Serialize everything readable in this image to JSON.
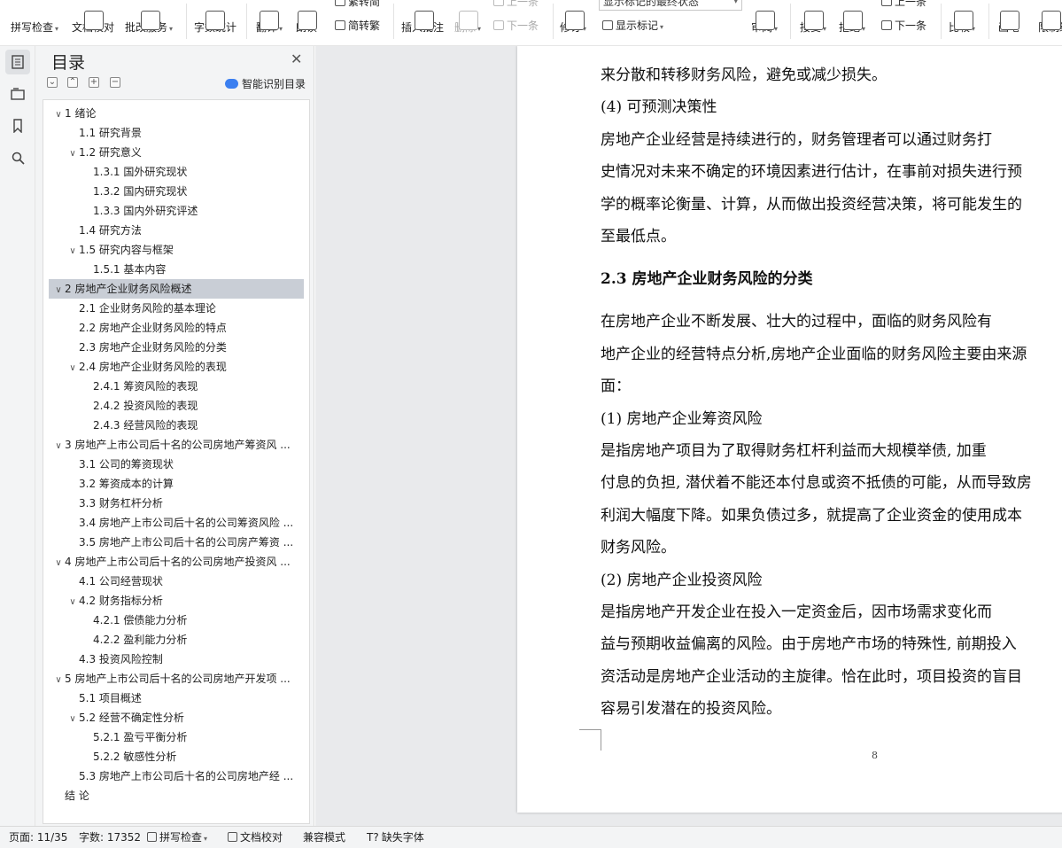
{
  "ribbon": {
    "spell_check": "拼写检查",
    "doc_proofread": "文档校对",
    "review_service": "批改服务",
    "word_count": "字数统计",
    "translate": "翻译",
    "read_aloud": "朗读",
    "trad_to_simp_top": "繁转简",
    "simp_to_trad": "简转繁",
    "insert_comment": "插入批注",
    "delete": "删除",
    "prev_comment": "上一条",
    "next_comment": "下一条",
    "revise": "修订",
    "markup_state": "显示标记的最终状态",
    "show_markup": "显示标记",
    "review": "审阅",
    "accept": "接受",
    "reject": "拒绝",
    "prev_change": "上一条",
    "next_change": "下一条",
    "compare": "比较",
    "pen": "画笔",
    "restrict": "限制编"
  },
  "toc": {
    "title": "目录",
    "smart_button": "智能识别目录",
    "items": [
      {
        "label": "1  绪论",
        "level": 1,
        "expandable": true
      },
      {
        "label": "1.1 研究背景",
        "level": 2,
        "expandable": false
      },
      {
        "label": "1.2 研究意义",
        "level": 2,
        "expandable": true
      },
      {
        "label": "1.3.1 国外研究现状",
        "level": 3,
        "expandable": false
      },
      {
        "label": "1.3.2 国内研究现状",
        "level": 3,
        "expandable": false
      },
      {
        "label": "1.3.3 国内外研究评述",
        "level": 3,
        "expandable": false
      },
      {
        "label": "1.4 研究方法",
        "level": 2,
        "expandable": false
      },
      {
        "label": "1.5 研究内容与框架",
        "level": 2,
        "expandable": true
      },
      {
        "label": "1.5.1 基本内容",
        "level": 3,
        "expandable": false
      },
      {
        "label": "2 房地产企业财务风险概述",
        "level": 1,
        "expandable": true,
        "selected": true
      },
      {
        "label": "2.1  企业财务风险的基本理论",
        "level": 2,
        "expandable": false
      },
      {
        "label": "2.2 房地产企业财务风险的特点",
        "level": 2,
        "expandable": false
      },
      {
        "label": "2.3 房地产企业财务风险的分类",
        "level": 2,
        "expandable": false
      },
      {
        "label": "2.4 房地产企业财务风险的表现",
        "level": 2,
        "expandable": true
      },
      {
        "label": "2.4.1 筹资风险的表现",
        "level": 3,
        "expandable": false
      },
      {
        "label": "2.4.2 投资风险的表现",
        "level": 3,
        "expandable": false
      },
      {
        "label": "2.4.3 经营风险的表现",
        "level": 3,
        "expandable": false
      },
      {
        "label": "3 房地产上市公司后十名的公司房地产筹资风 ...",
        "level": 1,
        "expandable": true
      },
      {
        "label": "3.1 公司的筹资现状",
        "level": 2,
        "expandable": false
      },
      {
        "label": "3.2 筹资成本的计算",
        "level": 2,
        "expandable": false
      },
      {
        "label": "3.3 财务杠杆分析",
        "level": 2,
        "expandable": false
      },
      {
        "label": "3.4 房地产上市公司后十名的公司筹资风险 ...",
        "level": 2,
        "expandable": false
      },
      {
        "label": "3.5 房地产上市公司后十名的公司房产筹资 ...",
        "level": 2,
        "expandable": false
      },
      {
        "label": "4  房地产上市公司后十名的公司房地产投资风 ...",
        "level": 1,
        "expandable": true
      },
      {
        "label": "4.1 公司经营现状",
        "level": 2,
        "expandable": false
      },
      {
        "label": "4.2 财务指标分析",
        "level": 2,
        "expandable": true
      },
      {
        "label": "4.2.1 偿债能力分析",
        "level": 3,
        "expandable": false
      },
      {
        "label": "4.2.2 盈利能力分析",
        "level": 3,
        "expandable": false
      },
      {
        "label": "4.3 投资风险控制",
        "level": 2,
        "expandable": false
      },
      {
        "label": "5 房地产上市公司后十名的公司房地产开发项 ...",
        "level": 1,
        "expandable": true
      },
      {
        "label": "5.1 项目概述",
        "level": 2,
        "expandable": false
      },
      {
        "label": "5.2 经营不确定性分析",
        "level": 2,
        "expandable": true
      },
      {
        "label": "5.2.1 盈亏平衡分析",
        "level": 3,
        "expandable": false
      },
      {
        "label": "5.2.2 敏感性分析",
        "level": 3,
        "expandable": false
      },
      {
        "label": "5.3 房地产上市公司后十名的公司房地产经 ...",
        "level": 2,
        "expandable": false
      },
      {
        "label": "结    论",
        "level": 1,
        "expandable": false
      }
    ]
  },
  "document": {
    "lines": [
      {
        "text": "来分散和转移财务风险，避免或减少损失。",
        "type": "body"
      },
      {
        "text": "    (4)  可预测决策性",
        "type": "body"
      },
      {
        "text": "    房地产企业经营是持续进行的，财务管理者可以通过财务打",
        "type": "body"
      },
      {
        "text": "史情况对未来不确定的环境因素进行估计，在事前对损失进行预",
        "type": "body"
      },
      {
        "text": "学的概率论衡量、计算，从而做出投资经营决策，将可能发生的",
        "type": "body"
      },
      {
        "text": "至最低点。",
        "type": "body"
      },
      {
        "text": "2.3 房地产企业财务风险的分类",
        "type": "heading"
      },
      {
        "text": "    在房地产企业不断发展、壮大的过程中，面临的财务风险有",
        "type": "body"
      },
      {
        "text": "地产企业的经营特点分析,房地产企业面临的财务风险主要由来源",
        "type": "body"
      },
      {
        "text": "面：",
        "type": "body"
      },
      {
        "text": "    (1)  房地产企业筹资风险",
        "type": "body"
      },
      {
        "text": "     是指房地产项目为了取得财务杠杆利益而大规模举债, 加重",
        "type": "body"
      },
      {
        "text": "付息的负担, 潜伏着不能还本付息或资不抵债的可能，从而导致房",
        "type": "body"
      },
      {
        "text": "利润大幅度下降。如果负债过多，就提高了企业资金的使用成本",
        "type": "body"
      },
      {
        "text": "财务风险。",
        "type": "body"
      },
      {
        "text": "    (2)  房地产企业投资风险",
        "type": "body"
      },
      {
        "text": "     是指房地产开发企业在投入一定资金后，因市场需求变化而",
        "type": "body"
      },
      {
        "text": "益与预期收益偏离的风险。由于房地产市场的特殊性, 前期投入",
        "type": "body"
      },
      {
        "text": "资活动是房地产企业活动的主旋律。恰在此时，项目投资的盲目",
        "type": "body"
      },
      {
        "text": "容易引发潜在的投资风险。",
        "type": "body"
      }
    ],
    "page_number": "8"
  },
  "status": {
    "page": "页面: 11/35",
    "words": "字数: 17352",
    "spell_check": "拼写检查",
    "proofread": "文档校对",
    "compat_mode": "兼容模式",
    "missing_fonts": "缺失字体"
  }
}
